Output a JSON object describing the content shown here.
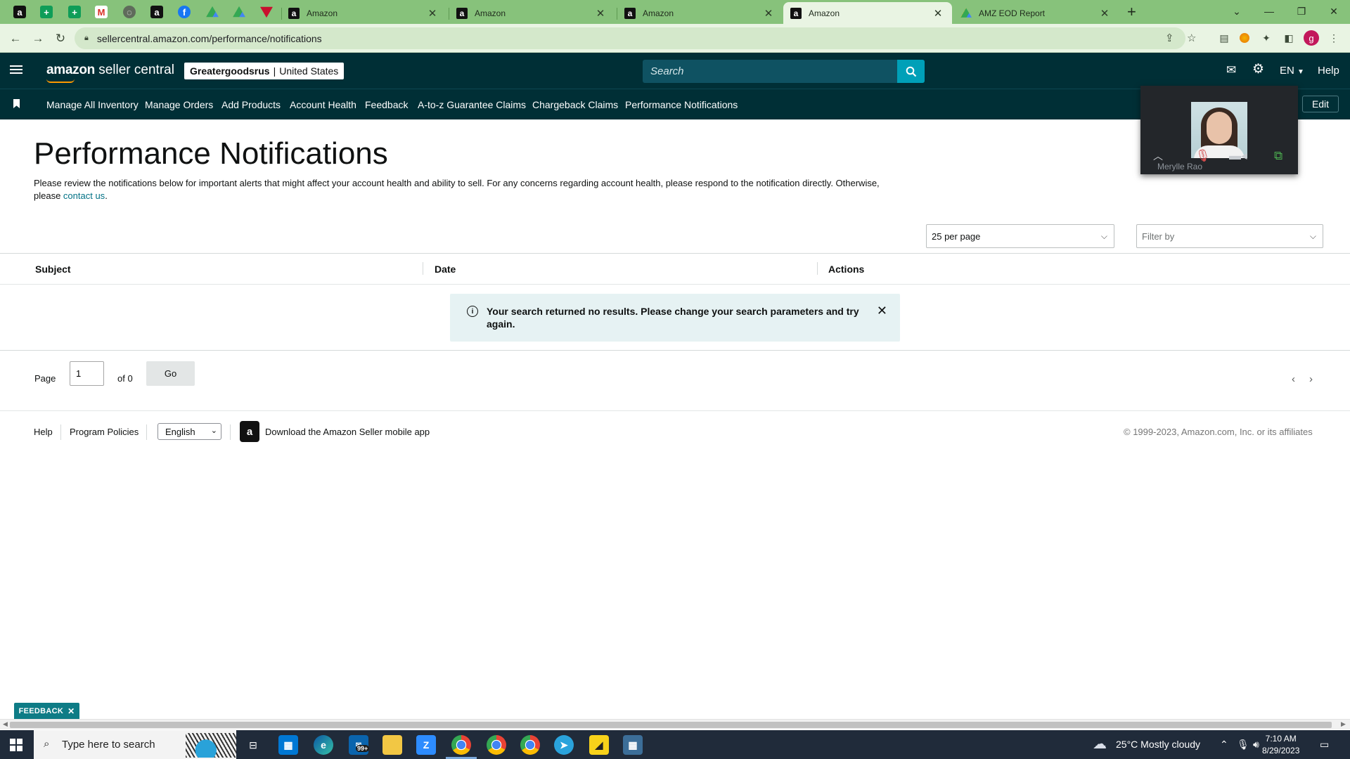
{
  "browser": {
    "tabs": [
      {
        "title": "Amazon",
        "active": false
      },
      {
        "title": "Amazon",
        "active": false
      },
      {
        "title": "Amazon",
        "active": false
      },
      {
        "title": "Amazon",
        "active": true
      },
      {
        "title": "AMZ EOD Report",
        "active": false
      }
    ],
    "new_tab": "+",
    "url": "sellercentral.amazon.com/performance/notifications",
    "profile_initial": "g"
  },
  "header": {
    "logo_brand": "amazon",
    "logo_suffix": "seller central",
    "store_name": "Greatergoodsrus",
    "store_region": "United States",
    "search_placeholder": "Search",
    "language": "EN",
    "help": "Help"
  },
  "nav": {
    "links": [
      "Manage All Inventory",
      "Manage Orders",
      "Add Products",
      "Account Health",
      "Feedback",
      "A-to-z Guarantee Claims",
      "Chargeback Claims",
      "Performance Notifications"
    ],
    "edit": "Edit"
  },
  "video": {
    "participant": "Merylle Rao"
  },
  "page": {
    "title": "Performance Notifications",
    "intro_line1": "Please review the notifications below for important alerts that might affect your account health and ability to sell. For any concerns regarding account health, please respond to the notification directly. Otherwise,",
    "intro_please": "please ",
    "intro_link": "contact us",
    "intro_end": ".",
    "per_page": "25 per page",
    "filter_placeholder": "Filter by"
  },
  "table": {
    "columns": [
      "Subject",
      "Date",
      "Actions"
    ],
    "alert_message": "Your search returned no results. Please change your search parameters and try again."
  },
  "pager": {
    "page_label": "Page",
    "page_value": "1",
    "of_label": "of 0",
    "go": "Go"
  },
  "footer": {
    "help": "Help",
    "policies": "Program Policies",
    "language": "English",
    "app": "Download the Amazon Seller mobile app",
    "copyright": "© 1999-2023, Amazon.com, Inc. or its affiliates"
  },
  "feedback_tab": "FEEDBACK",
  "taskbar": {
    "search": "Type here to search",
    "mail_badge": "99+",
    "weather": "25°C  Mostly cloudy",
    "time": "7:10 AM",
    "date": "8/29/2023"
  }
}
